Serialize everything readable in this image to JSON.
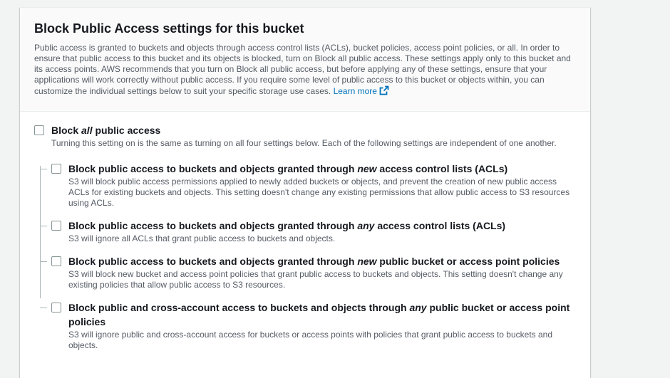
{
  "header": {
    "title": "Block Public Access settings for this bucket",
    "description": "Public access is granted to buckets and objects through access control lists (ACLs), bucket policies, access point policies, or all. In order to ensure that public access to this bucket and its objects is blocked, turn on Block all public access. These settings apply only to this bucket and its access points. AWS recommends that you turn on Block all public access, but before applying any of these settings, ensure that your applications will work correctly without public access. If you require some level of public access to this bucket or objects within, you can customize the individual settings below to suit your specific storage use cases.",
    "learn_more": "Learn more",
    "learn_more_icon": "external-link-icon"
  },
  "master": {
    "title_pre": "Block ",
    "title_em": "all",
    "title_post": " public access",
    "description": "Turning this setting on is the same as turning on all four settings below. Each of the following settings are independent of one another.",
    "checked": false
  },
  "options": [
    {
      "title_pre": "Block public access to buckets and objects granted through ",
      "title_em": "new",
      "title_post": " access control lists (ACLs)",
      "description": "S3 will block public access permissions applied to newly added buckets or objects, and prevent the creation of new public access ACLs for existing buckets and objects. This setting doesn't change any existing permissions that allow public access to S3 resources using ACLs.",
      "checked": false
    },
    {
      "title_pre": "Block public access to buckets and objects granted through ",
      "title_em": "any",
      "title_post": " access control lists (ACLs)",
      "description": "S3 will ignore all ACLs that grant public access to buckets and objects.",
      "checked": false
    },
    {
      "title_pre": "Block public access to buckets and objects granted through ",
      "title_em": "new",
      "title_post": " public bucket or access point policies",
      "description": "S3 will block new bucket and access point policies that grant public access to buckets and objects. This setting doesn't change any existing policies that allow public access to S3 resources.",
      "checked": false
    },
    {
      "title_pre": "Block public and cross-account access to buckets and objects through ",
      "title_em": "any",
      "title_post": " public bucket or access point policies",
      "description": "S3 will ignore public and cross-account access for buckets or access points with policies that grant public access to buckets and objects.",
      "checked": false
    }
  ],
  "colors": {
    "link": "#0073bb",
    "checkbox_border": "#879596"
  }
}
